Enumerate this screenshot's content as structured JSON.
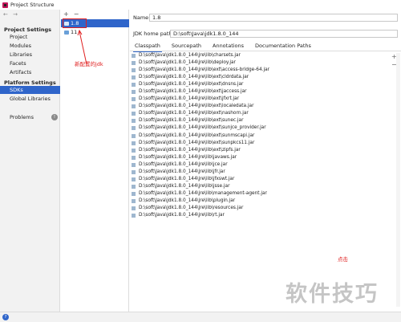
{
  "window": {
    "title": "Project Structure"
  },
  "nav": {
    "arrows": "← →",
    "project_settings_header": "Project Settings",
    "project_settings_items": [
      "Project",
      "Modules",
      "Libraries",
      "Facets",
      "Artifacts"
    ],
    "platform_settings_header": "Platform Settings",
    "platform_settings_items": [
      "SDKs",
      "Global Libraries"
    ],
    "problems_label": "Problems",
    "problems_badge": "!"
  },
  "sdk_list": {
    "add_label": "+",
    "remove_label": "−",
    "items": [
      "1.8",
      "11"
    ],
    "selected": "1.8"
  },
  "annotations": {
    "new_jdk": "新配置的jdk",
    "click": "点击"
  },
  "detail": {
    "name_label": "Name:",
    "name_value": "1.8",
    "jdk_home_label": "JDK home path:",
    "jdk_home_value": "D:\\soft\\Java\\jdk1.8.0_144",
    "tabs": [
      "Classpath",
      "Sourcepath",
      "Annotations",
      "Documentation Paths"
    ],
    "active_tab": "Classpath",
    "side_add": "+",
    "side_remove": "−",
    "classpath": [
      "D:\\soft\\Java\\jdk1.8.0_144\\jre\\lib\\charsets.jar",
      "D:\\soft\\Java\\jdk1.8.0_144\\jre\\lib\\deploy.jar",
      "D:\\soft\\Java\\jdk1.8.0_144\\jre\\lib\\ext\\access-bridge-64.jar",
      "D:\\soft\\Java\\jdk1.8.0_144\\jre\\lib\\ext\\cldrdata.jar",
      "D:\\soft\\Java\\jdk1.8.0_144\\jre\\lib\\ext\\dnsns.jar",
      "D:\\soft\\Java\\jdk1.8.0_144\\jre\\lib\\ext\\jaccess.jar",
      "D:\\soft\\Java\\jdk1.8.0_144\\jre\\lib\\ext\\jfxrt.jar",
      "D:\\soft\\Java\\jdk1.8.0_144\\jre\\lib\\ext\\localedata.jar",
      "D:\\soft\\Java\\jdk1.8.0_144\\jre\\lib\\ext\\nashorn.jar",
      "D:\\soft\\Java\\jdk1.8.0_144\\jre\\lib\\ext\\sunec.jar",
      "D:\\soft\\Java\\jdk1.8.0_144\\jre\\lib\\ext\\sunjce_provider.jar",
      "D:\\soft\\Java\\jdk1.8.0_144\\jre\\lib\\ext\\sunmscapi.jar",
      "D:\\soft\\Java\\jdk1.8.0_144\\jre\\lib\\ext\\sunpkcs11.jar",
      "D:\\soft\\Java\\jdk1.8.0_144\\jre\\lib\\ext\\zipfs.jar",
      "D:\\soft\\Java\\jdk1.8.0_144\\jre\\lib\\javaws.jar",
      "D:\\soft\\Java\\jdk1.8.0_144\\jre\\lib\\jce.jar",
      "D:\\soft\\Java\\jdk1.8.0_144\\jre\\lib\\jfr.jar",
      "D:\\soft\\Java\\jdk1.8.0_144\\jre\\lib\\jfxswt.jar",
      "D:\\soft\\Java\\jdk1.8.0_144\\jre\\lib\\jsse.jar",
      "D:\\soft\\Java\\jdk1.8.0_144\\jre\\lib\\management-agent.jar",
      "D:\\soft\\Java\\jdk1.8.0_144\\jre\\lib\\plugin.jar",
      "D:\\soft\\Java\\jdk1.8.0_144\\jre\\lib\\resources.jar",
      "D:\\soft\\Java\\jdk1.8.0_144\\jre\\lib\\rt.jar"
    ]
  },
  "watermark": "软件技巧",
  "colors": {
    "selection": "#2f65ca",
    "annotation": "#e02020"
  }
}
